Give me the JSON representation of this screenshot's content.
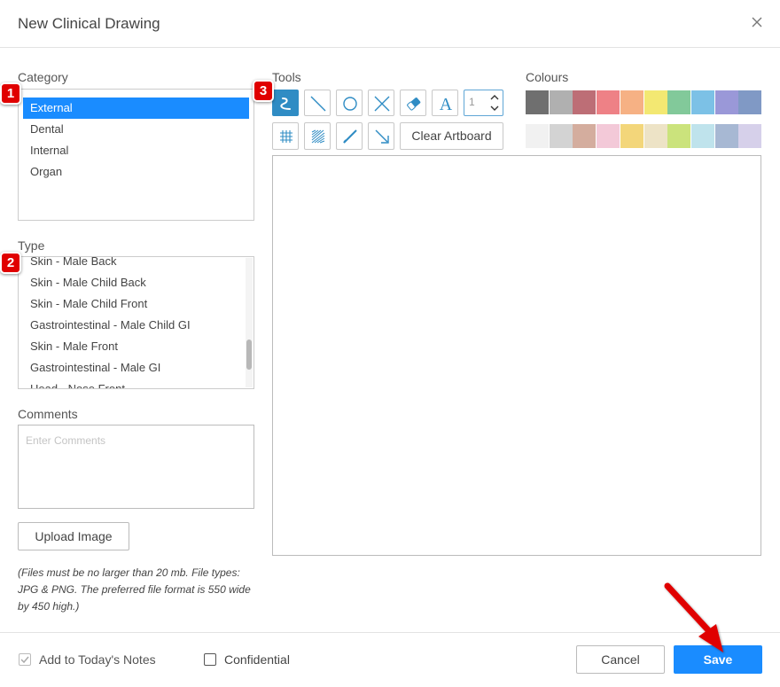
{
  "dialog": {
    "title": "New Clinical Drawing"
  },
  "category": {
    "label": "Category",
    "items": [
      "External",
      "Dental",
      "Internal",
      "Organ"
    ],
    "selected": "External"
  },
  "type": {
    "label": "Type",
    "items": [
      "Skin - Male Back",
      "Skin - Male Child Back",
      "Skin - Male Child Front",
      "Gastrointestinal - Male Child GI",
      "Skin - Male Front",
      "Gastrointestinal - Male GI",
      "Head - Nose Front"
    ]
  },
  "comments": {
    "label": "Comments",
    "placeholder": "Enter Comments"
  },
  "upload": {
    "label": "Upload Image",
    "note": "(Files must be no larger than 20 mb. File types: JPG & PNG. The preferred file format is 550 wide by 450 high.)"
  },
  "tools": {
    "label": "Tools",
    "icons": [
      "freehand-icon",
      "line-icon",
      "circle-icon",
      "cross-icon",
      "eraser-icon",
      "text-icon",
      "grid-icon",
      "hatch-icon",
      "pen-icon",
      "arrow-icon"
    ],
    "stroke_size": "1",
    "clear_label": "Clear Artboard"
  },
  "colours": {
    "label": "Colours",
    "row1": [
      "#6f6f6f",
      "#b0b0b0",
      "#bd6e76",
      "#ee8186",
      "#f6b184",
      "#f3e872",
      "#82c99a",
      "#7cc1e6",
      "#9a98d8",
      "#8099c5"
    ],
    "row2": [
      "#f1f1f1",
      "#d3d3d3",
      "#d4ad9e",
      "#f3c9d8",
      "#f3d67a",
      "#ede3c6",
      "#cbe37c",
      "#bfe3ec",
      "#a7b8d3",
      "#d6d0ea"
    ]
  },
  "footer": {
    "add_notes_label": "Add to Today's Notes",
    "add_notes_checked": true,
    "confidential_label": "Confidential",
    "confidential_checked": false,
    "cancel_label": "Cancel",
    "save_label": "Save"
  },
  "annotations": {
    "badges": [
      "1",
      "2",
      "3"
    ]
  }
}
